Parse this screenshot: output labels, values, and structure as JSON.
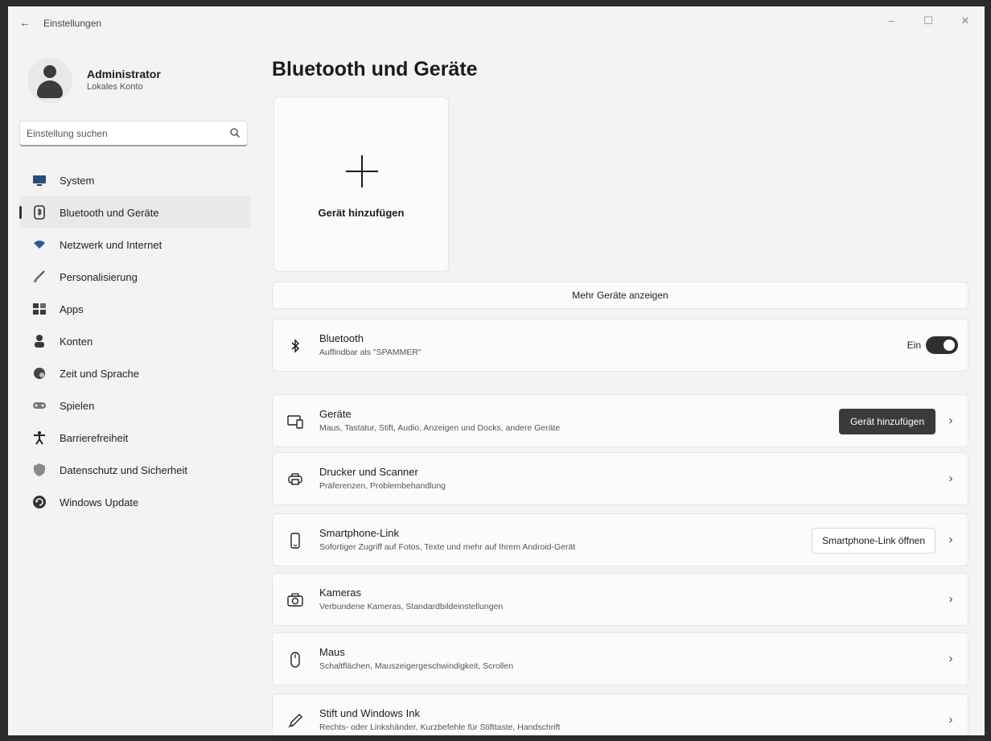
{
  "window": {
    "title": "Einstellungen",
    "back_glyph": "←",
    "minimize_glyph": "–",
    "maximize_glyph": "☐",
    "close_glyph": "✕"
  },
  "profile": {
    "name": "Administrator",
    "subtitle": "Lokales Konto"
  },
  "search": {
    "placeholder": "Einstellung suchen"
  },
  "sidebar": {
    "items": [
      {
        "label": "System",
        "icon": "monitor-icon",
        "active": false
      },
      {
        "label": "Bluetooth und Geräte",
        "icon": "bluetooth-devices-icon",
        "active": true
      },
      {
        "label": "Netzwerk und Internet",
        "icon": "wifi-icon",
        "active": false
      },
      {
        "label": "Personalisierung",
        "icon": "brush-icon",
        "active": false
      },
      {
        "label": "Apps",
        "icon": "apps-icon",
        "active": false
      },
      {
        "label": "Konten",
        "icon": "person-icon",
        "active": false
      },
      {
        "label": "Zeit und Sprache",
        "icon": "globe-clock-icon",
        "active": false
      },
      {
        "label": "Spielen",
        "icon": "gamepad-icon",
        "active": false
      },
      {
        "label": "Barrierefreiheit",
        "icon": "accessibility-icon",
        "active": false
      },
      {
        "label": "Datenschutz und Sicherheit",
        "icon": "shield-icon",
        "active": false
      },
      {
        "label": "Windows Update",
        "icon": "update-icon",
        "active": false
      }
    ]
  },
  "main": {
    "title": "Bluetooth und Geräte",
    "add_card_label": "Gerät hinzufügen",
    "more_devices": "Mehr Geräte anzeigen",
    "bluetooth": {
      "title": "Bluetooth",
      "desc": "Auffindbar als \"SPAMMER\"",
      "toggle_label": "Ein",
      "toggle_on": true
    },
    "rows": [
      {
        "title": "Geräte",
        "desc": "Maus, Tastatur, Stift, Audio, Anzeigen und Docks, andere Geräte",
        "icon": "devices-icon",
        "button": "Gerät hinzufügen"
      },
      {
        "title": "Drucker und Scanner",
        "desc": "Präferenzen, Problembehandlung",
        "icon": "printer-icon"
      },
      {
        "title": "Smartphone-Link",
        "desc": "Sofortiger Zugriff auf Fotos, Texte und mehr auf Ihrem Android-Gerät",
        "icon": "phone-icon",
        "button": "Smartphone-Link öffnen"
      },
      {
        "title": "Kameras",
        "desc": "Verbundene Kameras, Standardbildeinstellungen",
        "icon": "camera-icon"
      },
      {
        "title": "Maus",
        "desc": "Schaltflächen, Mauszeigergeschwindigkeit, Scrollen",
        "icon": "mouse-icon"
      },
      {
        "title": "Stift und Windows Ink",
        "desc": "Rechts- oder Linkshänder, Kurzbefehle für Stifttaste, Handschrift",
        "icon": "pen-icon"
      }
    ],
    "chevron_glyph": "›"
  }
}
